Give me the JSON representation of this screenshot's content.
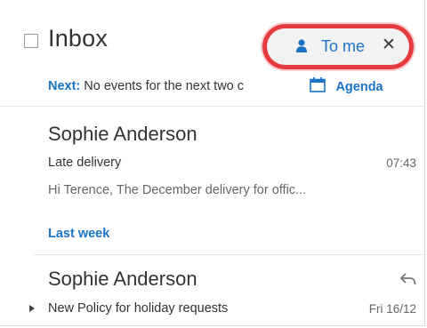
{
  "header": {
    "folder_title": "Inbox",
    "filter": {
      "icon": "person-icon",
      "label": "To me",
      "close_icon": "close-icon"
    }
  },
  "next_bar": {
    "prefix": "Next:",
    "text": "No events for the next two c",
    "agenda": {
      "icon": "calendar-icon",
      "label": "Agenda"
    }
  },
  "messages": [
    {
      "sender": "Sophie Anderson",
      "subject": "Late delivery",
      "time": "07:43",
      "preview": "Hi Terence,   The December delivery for offic..."
    }
  ],
  "groups": [
    {
      "label": "Last week",
      "messages": [
        {
          "sender": "Sophie Anderson",
          "subject": "New Policy for holiday requests",
          "time": "Fri 16/12",
          "status_icon": "reply-icon",
          "expand_icon": "expand-arrow-icon"
        }
      ]
    }
  ],
  "colors": {
    "accent": "#1a73c7",
    "highlight_ring": "#e73a3f",
    "pill_bg": "#f2f2f2"
  }
}
